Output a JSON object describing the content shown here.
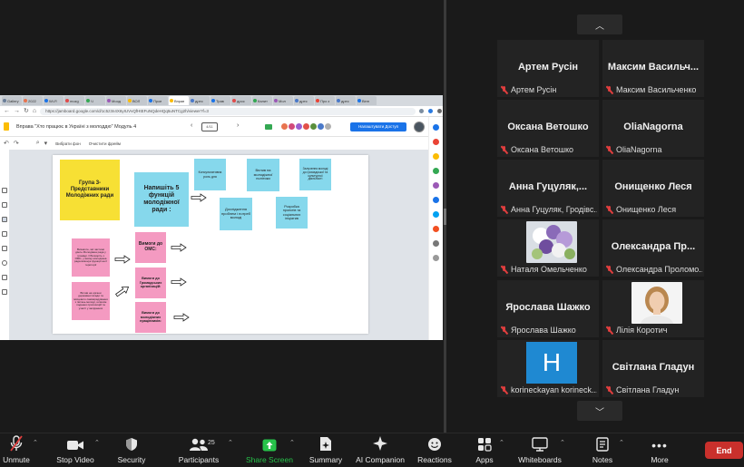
{
  "browser": {
    "tabs": [
      "Gallery",
      "2022",
      "Wi-Fi",
      "mozg",
      "Ч",
      "Моод",
      "ВОЛ",
      "Пров",
      "Вправ",
      "дрес",
      "Трав",
      "дрос",
      "Калит",
      "Мол",
      "дрес",
      "Про з",
      "дрес",
      "Вінн"
    ],
    "active_tab": 8,
    "url": "https://jamboard.google.com/d/1c5z3n4X6yIUVvQfHtEFuNQdeHQq5uNTCg2h/viewer?f=3"
  },
  "jamboard": {
    "title": "Вправа \"Хто працює в Україні з молоддю\" Модуль 4",
    "frame_indicator": "4/11",
    "share_label": "Налаштувати Доступ",
    "set_background": "Вибрати фон",
    "clear_frame": "Очистити фрейм",
    "notes": [
      {
        "id": "n1",
        "text": "Група 3-Представники Молодіжних ради",
        "color": "#f7e034"
      },
      {
        "id": "n2",
        "text": "Напишіть 5 функцій молодіжної ради :",
        "color": "#86d8ec"
      },
      {
        "id": "n3",
        "text": "Консультативна роль для",
        "color": "#86d8ec"
      },
      {
        "id": "n4",
        "text": "Вплив на молодіжної політики",
        "color": "#86d8ec"
      },
      {
        "id": "n5",
        "text": "Залучення молоді до громадської та культурної діяльності",
        "color": "#86d8ec"
      },
      {
        "id": "n6",
        "text": "Дослідження проблем і потреб молоді",
        "color": "#86d8ec"
      },
      {
        "id": "n7",
        "text": "Розробка проектів та соціальних ініціатив",
        "color": "#86d8ec"
      },
      {
        "id": "n8",
        "text": "Визначте, які частини діють Молодіжна рада у громаді. Обговоріть з ОМС, у якому молодіжна рада виконує функції на її території",
        "color": "#f49ac1"
      },
      {
        "id": "n9",
        "text": "Вплив на органи державної влади та місцевого самоврядування з питань молоді, шляхом подання пропозицій та участі у засіданнях",
        "color": "#f49ac1"
      },
      {
        "id": "n10",
        "text": "Вимоги до ОМС:",
        "color": "#f49ac1"
      },
      {
        "id": "n11",
        "text": "Вимоги до Громадських організацій:",
        "color": "#f49ac1"
      },
      {
        "id": "n12",
        "text": "Вимоги до молодіжних працівників:",
        "color": "#f49ac1"
      }
    ]
  },
  "gallery": {
    "tiles": [
      {
        "name": "Артем Русін",
        "label": "Артем Русін",
        "type": "name"
      },
      {
        "name": "Максим Васильч...",
        "label": "Максим Васильченко",
        "type": "name"
      },
      {
        "name": "Оксана Ветошко",
        "label": "Оксана Ветошко",
        "type": "name"
      },
      {
        "name": "OliaNagorna",
        "label": "OliaNagorna",
        "type": "name"
      },
      {
        "name": "Анна Гуцуляк,...",
        "label": "Анна Гуцуляк, Гродівс...",
        "type": "name"
      },
      {
        "name": "Онищенко Леся",
        "label": "Онищенко Леся",
        "type": "name"
      },
      {
        "name": "",
        "label": "Наталя Омельченко",
        "type": "flowers"
      },
      {
        "name": "Олександра Пр...",
        "label": "Олександра Проломо...",
        "type": "name"
      },
      {
        "name": "Ярослава Шажко",
        "label": "Ярослава Шажко",
        "type": "name"
      },
      {
        "name": "",
        "label": "Лілія Коротич",
        "type": "portrait"
      },
      {
        "name": "H",
        "label": "korineckayan korineck...",
        "type": "letter"
      },
      {
        "name": "Світлана Гладун",
        "label": "Світлана Гладун",
        "type": "name"
      }
    ]
  },
  "controls": {
    "unmute": "Unmute",
    "stop_video": "Stop Video",
    "security": "Security",
    "participants": "Participants",
    "participants_count": "25",
    "share_screen": "Share Screen",
    "summary": "Summary",
    "ai_companion": "AI Companion",
    "reactions": "Reactions",
    "apps": "Apps",
    "whiteboards": "Whiteboards",
    "notes": "Notes",
    "more": "More",
    "end": "End"
  },
  "colors": {
    "accent_green": "#27c24a",
    "end_red": "#c9302c",
    "mute_red": "#e03e3e",
    "note_yellow": "#f7e034",
    "note_blue": "#86d8ec",
    "note_pink": "#f49ac1"
  }
}
